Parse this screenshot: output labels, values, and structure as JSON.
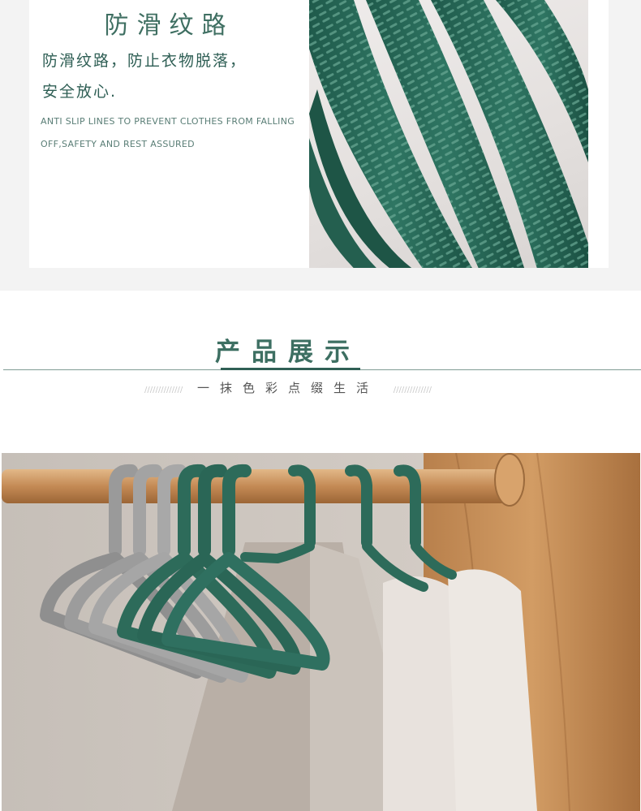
{
  "feature": {
    "title": "防滑纹路",
    "description_line1": "防滑纹路，防止衣物脱落，",
    "description_line2": "安全放心.",
    "english_line1": "ANTI SLIP LINES TO PREVENT CLOTHES FROM FALLING",
    "english_line2": "OFF,SAFETY AND REST ASSURED"
  },
  "section": {
    "title": "产品展示",
    "subtitle": "一抹色彩点缀生活",
    "left_mark": "//////////////",
    "right_mark": "//////////////"
  },
  "colors": {
    "accent_green": "#2f5f55",
    "hanger_green": "#2d6b5a",
    "hanger_grey": "#9a9a9a",
    "rod_wood": "#c9935e"
  },
  "images": {
    "detail": "anti-slip-hanger-closeup",
    "wardrobe": "hangers-on-wardrobe-rod"
  }
}
